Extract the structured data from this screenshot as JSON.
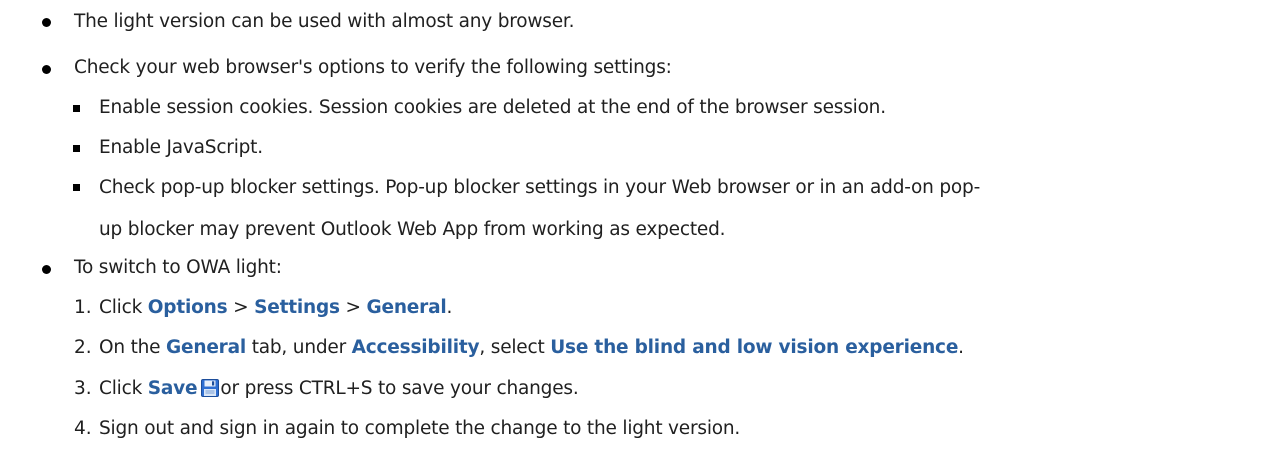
{
  "items": [
    {
      "text": "The light version can be used with almost any browser."
    },
    {
      "text": "Check your web browser's options to verify the following settings:"
    },
    {
      "text": "To switch to OWA light:"
    }
  ],
  "settings": [
    {
      "text": "Enable session cookies. Session cookies are deleted at the end of the browser session."
    },
    {
      "text": "Enable JavaScript."
    },
    {
      "line1": "Check pop-up blocker settings. Pop-up blocker settings in your Web browser or in an add-on pop-",
      "line2": "up blocker may prevent Outlook Web App from working as expected."
    }
  ],
  "steps": {
    "numbers": [
      "1.",
      "2.",
      "3.",
      "4."
    ],
    "step1": {
      "click": "Click ",
      "options": "Options",
      "sep1": " > ",
      "settings": "Settings",
      "sep2": " > ",
      "general": "General",
      "end": "."
    },
    "step2": {
      "on": "On the ",
      "general": "General",
      "tab": " tab, under ",
      "accessibility": "Accessibility",
      "select": ", select ",
      "blind": "Use the blind and low vision experience",
      "end": "."
    },
    "step3": {
      "click": "Click ",
      "save": "Save",
      "rest": "or press CTRL+S to save your changes."
    },
    "step4": {
      "text": "Sign out and sign in again to complete the change to the light version."
    }
  },
  "colors": {
    "ui_term": "#2a5f9e",
    "text": "#202020"
  },
  "icons": {
    "save": "floppy-disk-save-icon"
  }
}
